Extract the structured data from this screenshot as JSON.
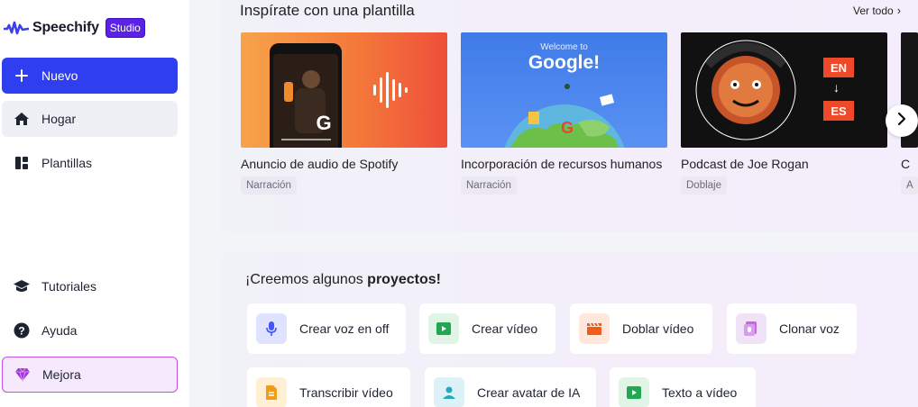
{
  "brand": {
    "name": "Speechify",
    "badge": "Studio"
  },
  "sidebar": {
    "items": [
      {
        "label": "Nuevo",
        "icon": "plus-icon"
      },
      {
        "label": "Hogar",
        "icon": "home-icon"
      },
      {
        "label": "Plantillas",
        "icon": "templates-icon"
      },
      {
        "label": "Tutoriales",
        "icon": "graduation-cap-icon"
      },
      {
        "label": "Ayuda",
        "icon": "help-icon"
      },
      {
        "label": "Mejora",
        "icon": "diamond-icon"
      }
    ]
  },
  "templates": {
    "title": "Inspírate con una plantilla",
    "see_all": "Ver todo",
    "cards": [
      {
        "name": "Anuncio de audio de Spotify",
        "tag": "Narración"
      },
      {
        "name": "Incorporación de recursos humanos",
        "tag": "Narración",
        "thumb_title": "Google!",
        "thumb_sub": "Welcome to"
      },
      {
        "name": "Podcast de Joe Rogan",
        "tag": "Doblaje",
        "lang_from": "EN",
        "lang_to": "ES"
      },
      {
        "name": "C",
        "tag": "A"
      }
    ]
  },
  "projects": {
    "title_prefix": "¡Creemos algunos ",
    "title_bold": "proyectos!",
    "actions": [
      {
        "label": "Crear voz en off",
        "icon": "microphone-icon",
        "color": "#dfe3ff"
      },
      {
        "label": "Crear vídeo",
        "icon": "video-play-icon",
        "color": "#e0f5e6"
      },
      {
        "label": "Doblar vídeo",
        "icon": "clapperboard-icon",
        "color": "#ffe8db"
      },
      {
        "label": "Clonar voz",
        "icon": "voice-clone-icon",
        "color": "#f1e3f7"
      },
      {
        "label": "Transcribir vídeo",
        "icon": "document-icon",
        "color": "#fff0d4"
      },
      {
        "label": "Crear avatar de IA",
        "icon": "avatar-icon",
        "color": "#dcf2f6"
      },
      {
        "label": "Texto a vídeo",
        "icon": "video-play-icon",
        "color": "#e0f5e6"
      }
    ]
  },
  "colors": {
    "primary": "#2f3ff0",
    "brand_badge": "#5b21e6",
    "upgrade_border": "#c14fe0"
  }
}
